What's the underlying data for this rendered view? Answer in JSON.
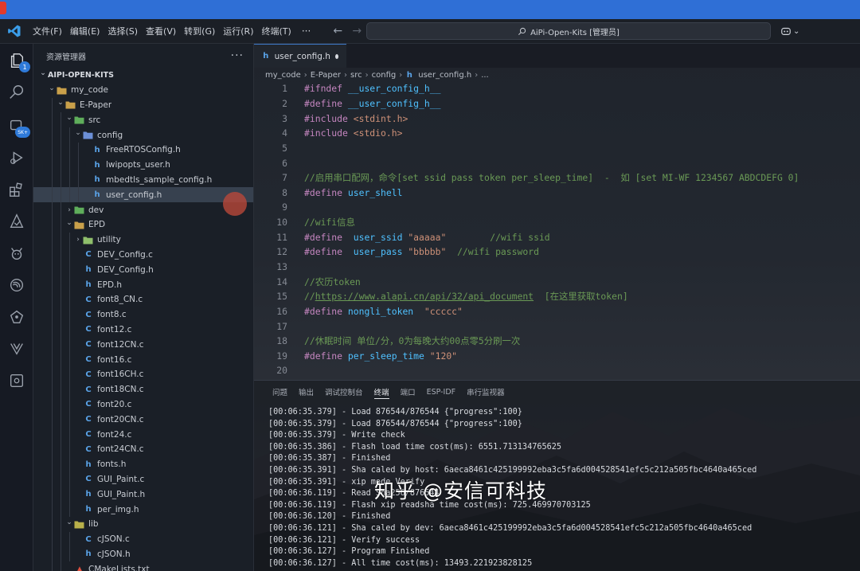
{
  "window": {
    "title": "AiPi-Open-Kits [管理员]"
  },
  "menu": {
    "items": [
      "文件(F)",
      "编辑(E)",
      "选择(S)",
      "查看(V)",
      "转到(G)",
      "运行(R)",
      "终端(T)"
    ],
    "more": "···"
  },
  "activity_bar": {
    "items": [
      {
        "icon": "files-icon",
        "badge": "1"
      },
      {
        "icon": "search-icon"
      },
      {
        "icon": "sdk-icon",
        "badge": "SK+"
      },
      {
        "icon": "run-debug-icon"
      },
      {
        "icon": "extensions-icon"
      },
      {
        "icon": "deploy-icon"
      },
      {
        "icon": "bug-icon"
      },
      {
        "icon": "esp-idf-icon"
      },
      {
        "icon": "azure-icon"
      },
      {
        "icon": "xrs-icon"
      },
      {
        "icon": "remote-explorer-icon"
      }
    ]
  },
  "explorer": {
    "title": "资源管理器",
    "more": "···",
    "items": [
      {
        "label": "AIPI-OPEN-KITS",
        "type": "root",
        "depth": 0,
        "expanded": true
      },
      {
        "label": "my_code",
        "type": "folder",
        "depth": 1,
        "expanded": true
      },
      {
        "label": "E-Paper",
        "type": "folder",
        "depth": 2,
        "expanded": true
      },
      {
        "label": "src",
        "type": "folder-src",
        "depth": 3,
        "expanded": true
      },
      {
        "label": "config",
        "type": "folder-config",
        "depth": 4,
        "expanded": true
      },
      {
        "label": "FreeRTOSConfig.h",
        "type": "h",
        "depth": 5
      },
      {
        "label": "lwipopts_user.h",
        "type": "h",
        "depth": 5
      },
      {
        "label": "mbedtls_sample_config.h",
        "type": "h",
        "depth": 5
      },
      {
        "label": "user_config.h",
        "type": "h",
        "depth": 5,
        "selected": true
      },
      {
        "label": "dev",
        "type": "folder-src",
        "depth": 3,
        "expanded": false
      },
      {
        "label": "EPD",
        "type": "folder",
        "depth": 3,
        "expanded": true
      },
      {
        "label": "utility",
        "type": "folder-util",
        "depth": 4,
        "expanded": false
      },
      {
        "label": "DEV_Config.c",
        "type": "c",
        "depth": 4
      },
      {
        "label": "DEV_Config.h",
        "type": "h",
        "depth": 4
      },
      {
        "label": "EPD.h",
        "type": "h",
        "depth": 4
      },
      {
        "label": "font8_CN.c",
        "type": "c",
        "depth": 4
      },
      {
        "label": "font8.c",
        "type": "c",
        "depth": 4
      },
      {
        "label": "font12.c",
        "type": "c",
        "depth": 4
      },
      {
        "label": "font12CN.c",
        "type": "c",
        "depth": 4
      },
      {
        "label": "font16.c",
        "type": "c",
        "depth": 4
      },
      {
        "label": "font16CH.c",
        "type": "c",
        "depth": 4
      },
      {
        "label": "font18CN.c",
        "type": "c",
        "depth": 4
      },
      {
        "label": "font20.c",
        "type": "c",
        "depth": 4
      },
      {
        "label": "font20CN.c",
        "type": "c",
        "depth": 4
      },
      {
        "label": "font24.c",
        "type": "c",
        "depth": 4
      },
      {
        "label": "font24CN.c",
        "type": "c",
        "depth": 4
      },
      {
        "label": "fonts.h",
        "type": "h",
        "depth": 4
      },
      {
        "label": "GUI_Paint.c",
        "type": "c",
        "depth": 4
      },
      {
        "label": "GUI_Paint.h",
        "type": "h",
        "depth": 4
      },
      {
        "label": "per_img.h",
        "type": "h",
        "depth": 4
      },
      {
        "label": "lib",
        "type": "folder-lib",
        "depth": 3,
        "expanded": true
      },
      {
        "label": "cJSON.c",
        "type": "c",
        "depth": 4
      },
      {
        "label": "cJSON.h",
        "type": "h",
        "depth": 4
      },
      {
        "label": "CMakeLists.txt",
        "type": "cmake",
        "depth": 3
      }
    ]
  },
  "editor": {
    "tab": {
      "label": "user_config.h",
      "modified": true
    },
    "breadcrumb": [
      "my_code",
      "E-Paper",
      "src",
      "config",
      "user_config.h",
      "..."
    ],
    "lines": [
      {
        "n": "1",
        "parts": [
          [
            "kw",
            "#ifndef"
          ],
          [
            "mid",
            " "
          ],
          [
            "macro",
            "__user_config_h__"
          ]
        ]
      },
      {
        "n": "2",
        "parts": [
          [
            "kw",
            "#define"
          ],
          [
            "mid",
            " "
          ],
          [
            "macro",
            "__user_config_h__"
          ]
        ]
      },
      {
        "n": "3",
        "parts": [
          [
            "kw",
            "#include"
          ],
          [
            "mid",
            " "
          ],
          [
            "str",
            "<stdint.h>"
          ]
        ]
      },
      {
        "n": "4",
        "parts": [
          [
            "kw",
            "#include"
          ],
          [
            "mid",
            " "
          ],
          [
            "str",
            "<stdio.h>"
          ]
        ]
      },
      {
        "n": "5",
        "parts": []
      },
      {
        "n": "6",
        "parts": []
      },
      {
        "n": "7",
        "parts": [
          [
            "cm",
            "//启用串口配网，命令[set ssid pass token per_sleep_time]  -  如 [set MI-WF 1234567 ABDCDEFG 0]"
          ]
        ]
      },
      {
        "n": "8",
        "parts": [
          [
            "kw",
            "#define"
          ],
          [
            "mid",
            " "
          ],
          [
            "macro",
            "user_shell"
          ]
        ]
      },
      {
        "n": "9",
        "parts": []
      },
      {
        "n": "10",
        "parts": [
          [
            "cm",
            "//wifi信息"
          ]
        ]
      },
      {
        "n": "11",
        "parts": [
          [
            "kw",
            "#define"
          ],
          [
            "mid",
            "  "
          ],
          [
            "macro",
            "user_ssid"
          ],
          [
            "mid",
            " "
          ],
          [
            "str",
            "\"aaaaa\""
          ],
          [
            "mid",
            "        "
          ],
          [
            "cm",
            "//wifi ssid"
          ]
        ]
      },
      {
        "n": "12",
        "parts": [
          [
            "kw",
            "#define"
          ],
          [
            "mid",
            "  "
          ],
          [
            "macro",
            "user_pass"
          ],
          [
            "mid",
            " "
          ],
          [
            "str",
            "\"bbbbb\""
          ],
          [
            "mid",
            "  "
          ],
          [
            "cm",
            "//wifi password"
          ]
        ]
      },
      {
        "n": "13",
        "parts": []
      },
      {
        "n": "14",
        "parts": [
          [
            "cm",
            "//农历token"
          ]
        ]
      },
      {
        "n": "15",
        "parts": [
          [
            "cm",
            "//"
          ],
          [
            "cm-link",
            "https://www.alapi.cn/api/32/api_document"
          ],
          [
            "cm",
            "  [在这里获取token]"
          ]
        ]
      },
      {
        "n": "16",
        "parts": [
          [
            "kw",
            "#define"
          ],
          [
            "mid",
            " "
          ],
          [
            "macro",
            "nongli_token"
          ],
          [
            "mid",
            "  "
          ],
          [
            "str",
            "\"ccccc\""
          ]
        ]
      },
      {
        "n": "17",
        "parts": []
      },
      {
        "n": "18",
        "parts": [
          [
            "cm",
            "//休眠时间 单位/分，0为每晚大约00点零5分刷一次"
          ]
        ]
      },
      {
        "n": "19",
        "parts": [
          [
            "kw",
            "#define"
          ],
          [
            "mid",
            " "
          ],
          [
            "macro",
            "per_sleep_time"
          ],
          [
            "mid",
            " "
          ],
          [
            "str",
            "\"120\""
          ]
        ]
      },
      {
        "n": "20",
        "parts": []
      }
    ]
  },
  "panel": {
    "tabs": [
      {
        "label": "问题"
      },
      {
        "label": "输出"
      },
      {
        "label": "调试控制台"
      },
      {
        "label": "终端",
        "active": true
      },
      {
        "label": "端口"
      },
      {
        "label": "ESP-IDF"
      },
      {
        "label": "串行监视器"
      }
    ],
    "terminal_lines": [
      "[00:06:35.379] - Load 876544/876544 {\"progress\":100}",
      "[00:06:35.379] - Load 876544/876544 {\"progress\":100}",
      "[00:06:35.379] - Write check",
      "[00:06:35.386] - Flash load time cost(ms): 6551.713134765625",
      "[00:06:35.387] - Finished",
      "[00:06:35.391] - Sha caled by host: 6aeca8461c425199992eba3c5fa6d004528541efc5c212a505fbc4640a465ced",
      "[00:06:35.391] - xip mode Verify",
      "[00:06:36.119] - Read Sha256/876544",
      "[00:06:36.119] - Flash xip readsha time cost(ms): 725.469970703125",
      "[00:06:36.120] - Finished",
      "[00:06:36.121] - Sha caled by dev: 6aeca8461c425199992eba3c5fa6d004528541efc5c212a505fbc4640a465ced",
      "[00:06:36.121] - Verify success",
      "[00:06:36.127] - Program Finished",
      "[00:06:36.127] - All time cost(ms): 13493.221923828125"
    ]
  },
  "watermark": "知乎 @安信可科技",
  "colors": {
    "accent": "#3d78c9",
    "keyword": "#c586c0",
    "macro": "#4fc1ff",
    "string": "#ce9178",
    "comment": "#6a9955"
  }
}
